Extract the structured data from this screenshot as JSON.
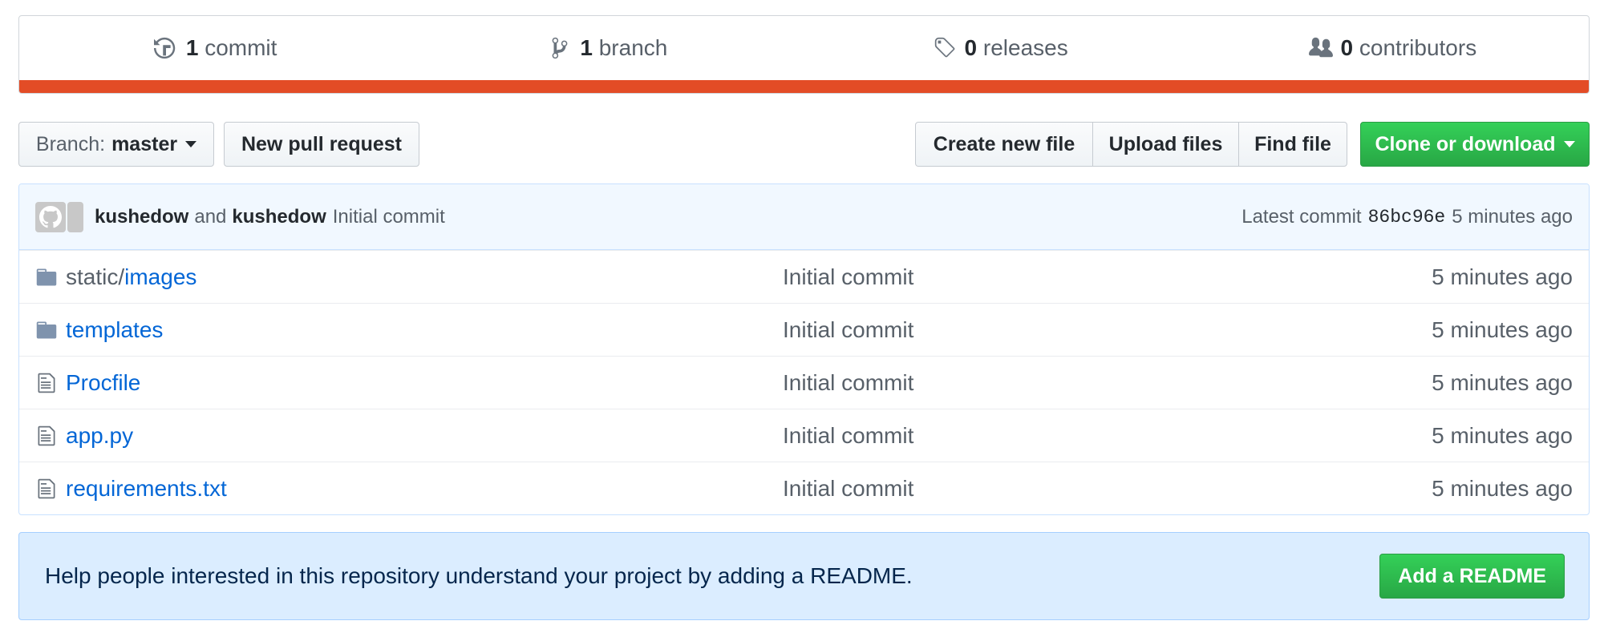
{
  "summary": {
    "commits": {
      "count": "1",
      "label": "commit"
    },
    "branches": {
      "count": "1",
      "label": "branch"
    },
    "releases": {
      "count": "0",
      "label": "releases"
    },
    "contributors": {
      "count": "0",
      "label": "contributors"
    },
    "language_color": "#e34c26"
  },
  "toolbar": {
    "branch_prefix": "Branch:",
    "branch_name": "master",
    "new_pull_request": "New pull request",
    "create_new_file": "Create new file",
    "upload_files": "Upload files",
    "find_file": "Find file",
    "clone_or_download": "Clone or download"
  },
  "commit_tease": {
    "author": "kushedow",
    "conjunction": "and",
    "committer": "kushedow",
    "message": "Initial commit",
    "latest_label": "Latest commit",
    "sha": "86bc96e",
    "age": "5 minutes ago"
  },
  "files": [
    {
      "type": "folder",
      "prefix": "static/",
      "name": "images",
      "message": "Initial commit",
      "age": "5 minutes ago"
    },
    {
      "type": "folder",
      "prefix": "",
      "name": "templates",
      "message": "Initial commit",
      "age": "5 minutes ago"
    },
    {
      "type": "file",
      "prefix": "",
      "name": "Procfile",
      "message": "Initial commit",
      "age": "5 minutes ago"
    },
    {
      "type": "file",
      "prefix": "",
      "name": "app.py",
      "message": "Initial commit",
      "age": "5 minutes ago"
    },
    {
      "type": "file",
      "prefix": "",
      "name": "requirements.txt",
      "message": "Initial commit",
      "age": "5 minutes ago"
    }
  ],
  "readme": {
    "text": "Help people interested in this repository understand your project by adding a README.",
    "button": "Add a README"
  }
}
